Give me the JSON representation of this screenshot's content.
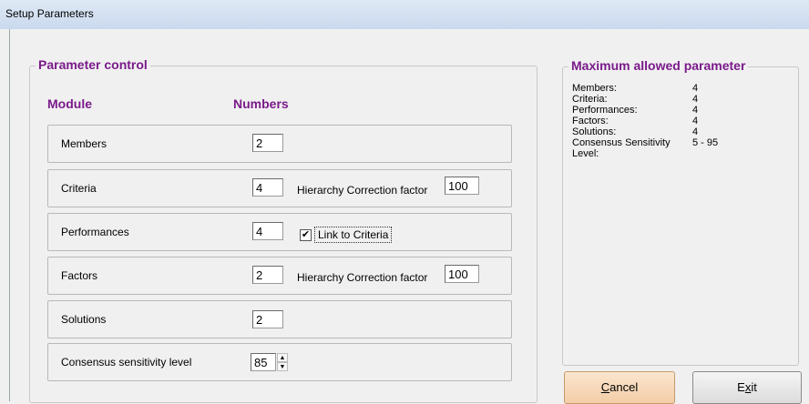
{
  "window": {
    "title": "Setup Parameters"
  },
  "parameter_control": {
    "legend": "Parameter control",
    "col_module": "Module",
    "col_numbers": "Numbers",
    "rows": [
      {
        "label": "Members",
        "value": "2"
      },
      {
        "label": "Criteria",
        "value": "4",
        "extra_label": "Hierarchy Correction factor",
        "extra_value": "100"
      },
      {
        "label": "Performances",
        "value": "4",
        "checkbox_label": "Link to Criteria",
        "checked": true,
        "check_glyph": "✔"
      },
      {
        "label": "Factors",
        "value": "2",
        "extra_label": "Hierarchy Correction factor",
        "extra_value": "100"
      },
      {
        "label": "Solutions",
        "value": "2"
      },
      {
        "label": "Consensus sensitivity level",
        "value": "85"
      }
    ],
    "spinner": {
      "up": "▲",
      "down": "▼"
    }
  },
  "max_allowed": {
    "legend": "Maximum allowed parameter",
    "items": [
      {
        "key": "Members:",
        "value": "4"
      },
      {
        "key": "Criteria:",
        "value": "4"
      },
      {
        "key": "Performances:",
        "value": "4"
      },
      {
        "key": "Factors:",
        "value": "4"
      },
      {
        "key": "Solutions:",
        "value": "4"
      },
      {
        "key": "Consensus Sensitivity",
        "value": "5 - 95"
      },
      {
        "key": "Level:",
        "value": ""
      }
    ]
  },
  "buttons": {
    "cancel": {
      "mnemonic": "C",
      "rest": "ancel"
    },
    "exit": {
      "pre": "E",
      "mnemonic": "x",
      "rest": "it"
    }
  }
}
